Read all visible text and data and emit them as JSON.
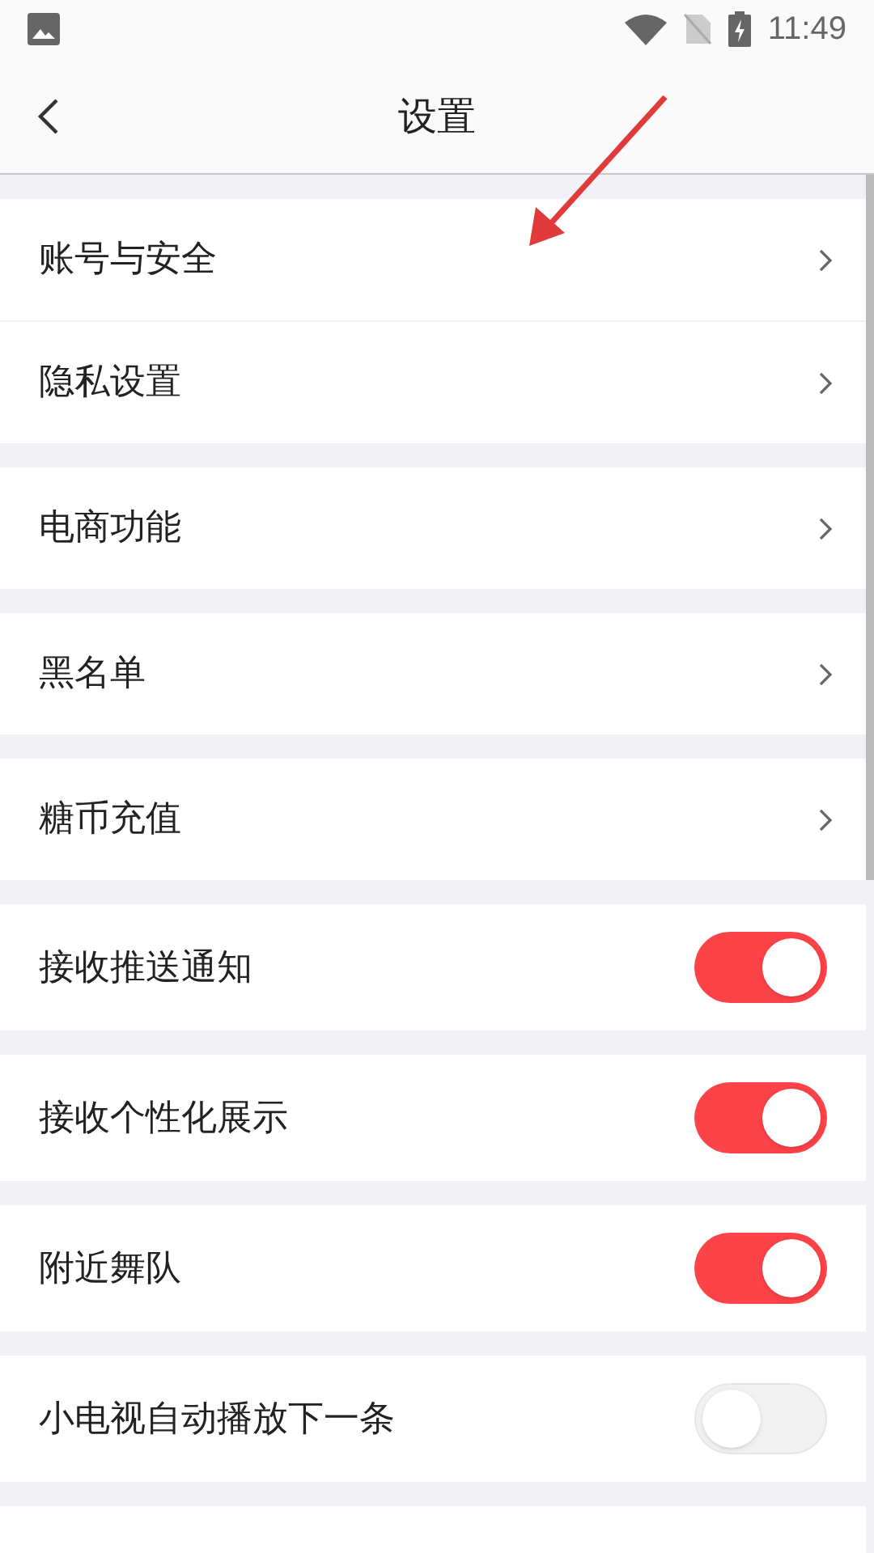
{
  "status_bar": {
    "time": "11:49"
  },
  "header": {
    "title": "设置"
  },
  "sections": [
    {
      "items": [
        {
          "kind": "link",
          "label": "账号与安全"
        },
        {
          "kind": "link",
          "label": "隐私设置"
        }
      ]
    },
    {
      "items": [
        {
          "kind": "link",
          "label": "电商功能"
        }
      ]
    },
    {
      "items": [
        {
          "kind": "link",
          "label": "黑名单"
        }
      ]
    },
    {
      "items": [
        {
          "kind": "link",
          "label": "糖币充值"
        }
      ]
    },
    {
      "items": [
        {
          "kind": "toggle",
          "label": "接收推送通知",
          "on": true
        }
      ]
    },
    {
      "items": [
        {
          "kind": "toggle",
          "label": "接收个性化展示",
          "on": true
        }
      ]
    },
    {
      "items": [
        {
          "kind": "toggle",
          "label": "附近舞队",
          "on": true
        }
      ]
    },
    {
      "items": [
        {
          "kind": "toggle",
          "label": "小电视自动播放下一条",
          "on": false
        }
      ]
    }
  ]
}
